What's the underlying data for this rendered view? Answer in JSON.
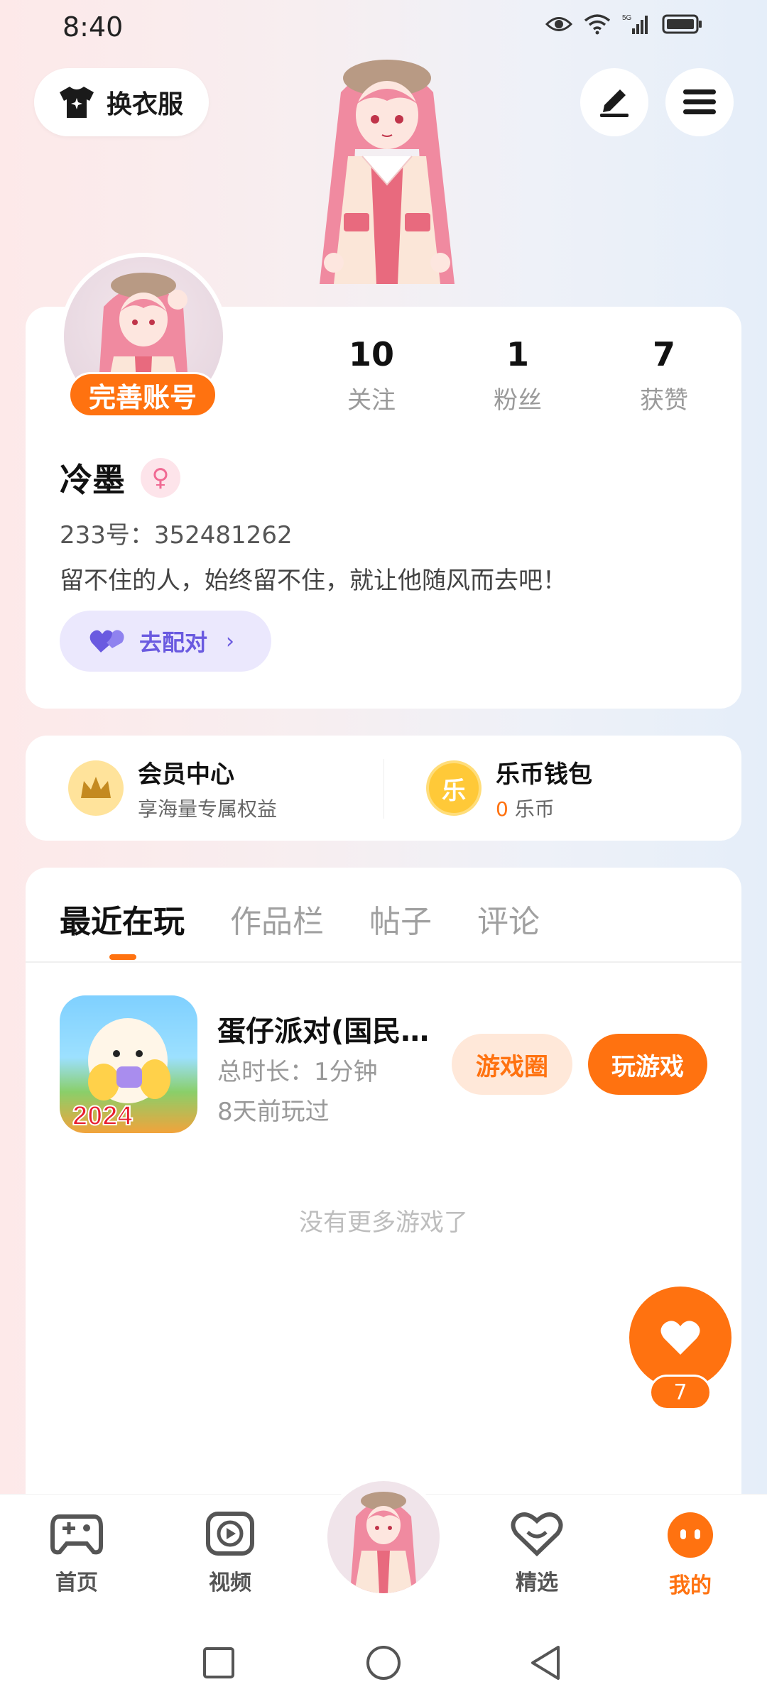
{
  "status_bar": {
    "time": "8:40"
  },
  "top": {
    "outfit_label": "换衣服"
  },
  "profile": {
    "complete_account": "完善账号",
    "stats": [
      {
        "value": "10",
        "label": "关注"
      },
      {
        "value": "1",
        "label": "粉丝"
      },
      {
        "value": "7",
        "label": "获赞"
      }
    ],
    "username": "冷墨",
    "gender_symbol": "♀",
    "user_id": "233号：352481262",
    "bio": "留不住的人，始终留不住，就让他随风而去吧！",
    "match_label": "去配对"
  },
  "perks": {
    "vip": {
      "title": "会员中心",
      "subtitle": "享海量专属权益"
    },
    "wallet": {
      "title": "乐币钱包",
      "coin_icon_text": "乐",
      "amount": "0",
      "unit": "乐币"
    }
  },
  "tabs": [
    "最近在玩",
    "作品栏",
    "帖子",
    "评论"
  ],
  "game": {
    "title": "蛋仔派对(国民…",
    "icon_text": "2024",
    "duration": "总时长：1分钟",
    "last_played": "8天前玩过",
    "circle_label": "游戏圈",
    "play_label": "玩游戏"
  },
  "no_more": "没有更多游戏了",
  "like": {
    "count": "7"
  },
  "bottom_nav": [
    {
      "label": "首页",
      "icon": "gamepad-icon"
    },
    {
      "label": "视频",
      "icon": "video-play-icon"
    },
    {
      "label": "精选",
      "icon": "heart-icon"
    },
    {
      "label": "我的",
      "icon": "face-icon"
    }
  ],
  "colors": {
    "accent": "#ff7210",
    "match_purple": "#6a5ae0"
  }
}
